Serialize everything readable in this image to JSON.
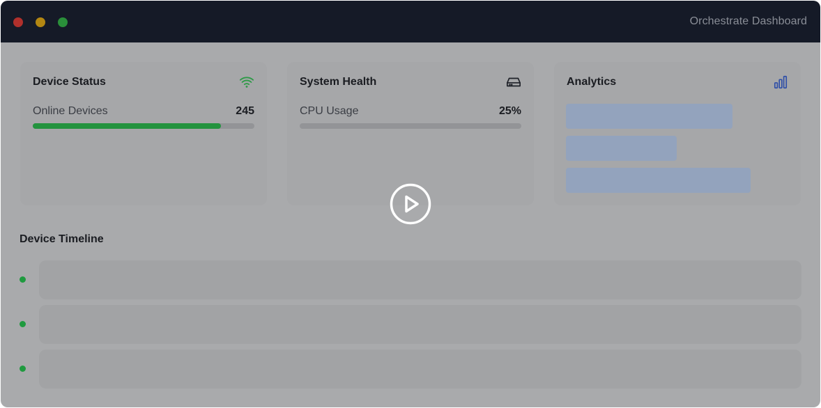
{
  "window": {
    "title": "Orchestrate Dashboard",
    "controls": [
      "close",
      "minimize",
      "zoom"
    ]
  },
  "cards": {
    "device_status": {
      "title": "Device Status",
      "icon": "wifi-icon",
      "metric_label": "Online Devices",
      "metric_value": "245",
      "progress_fraction": 0.85
    },
    "system_health": {
      "title": "System Health",
      "icon": "hard-drive-icon",
      "metric_label": "CPU Usage",
      "metric_value": "25%",
      "progress_fraction": 0
    },
    "analytics": {
      "title": "Analytics",
      "icon": "bar-chart-icon",
      "placeholder_bars": 3
    }
  },
  "timeline": {
    "title": "Device Timeline",
    "item_count": 3
  },
  "overlay": {
    "icon": "play-icon"
  },
  "colors": {
    "titlebar": "#151a27",
    "accent_green": "#23933e",
    "analytics_blue": "#2f4fa8"
  }
}
